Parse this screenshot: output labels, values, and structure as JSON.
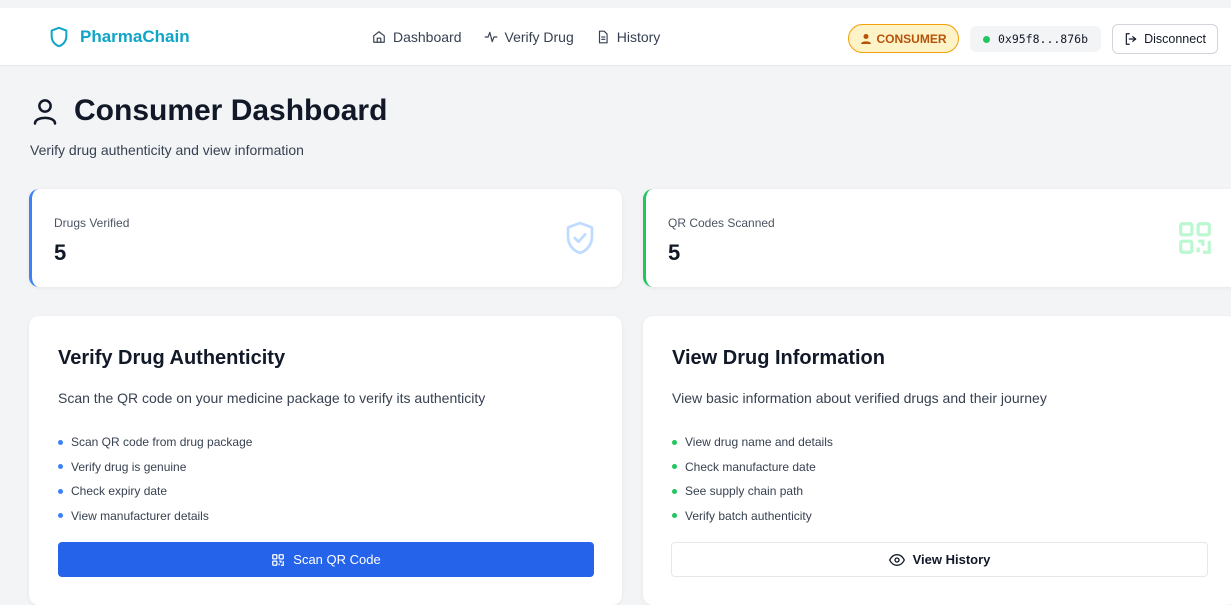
{
  "app": {
    "name": "PharmaChain",
    "brand_color": "#0ea5c7"
  },
  "nav": [
    {
      "label": "Dashboard",
      "icon": "home-icon"
    },
    {
      "label": "Verify Drug",
      "icon": "activity-icon"
    },
    {
      "label": "History",
      "icon": "file-text-icon"
    }
  ],
  "header": {
    "role": "CONSUMER",
    "wallet": "0x95f8...876b",
    "disconnect_label": "Disconnect"
  },
  "page": {
    "title": "Consumer Dashboard",
    "subtitle": "Verify drug authenticity and view information"
  },
  "stats": [
    {
      "label": "Drugs Verified",
      "value": "5",
      "icon": "shield-check-icon",
      "accent": "#3b82f6"
    },
    {
      "label": "QR Codes Scanned",
      "value": "5",
      "icon": "qr-code-icon",
      "accent": "#22c55e"
    }
  ],
  "cards": {
    "verify": {
      "title": "Verify Drug Authenticity",
      "description": "Scan the QR code on your medicine package to verify its authenticity",
      "bullets": [
        "Scan QR code from drug package",
        "Verify drug is genuine",
        "Check expiry date",
        "View manufacturer details"
      ],
      "button_label": "Scan QR Code",
      "accent": "#2563eb"
    },
    "info": {
      "title": "View Drug Information",
      "description": "View basic information about verified drugs and their journey",
      "bullets": [
        "View drug name and details",
        "Check manufacture date",
        "See supply chain path",
        "Verify batch authenticity"
      ],
      "button_label": "View History",
      "accent": "#22c55e"
    }
  }
}
